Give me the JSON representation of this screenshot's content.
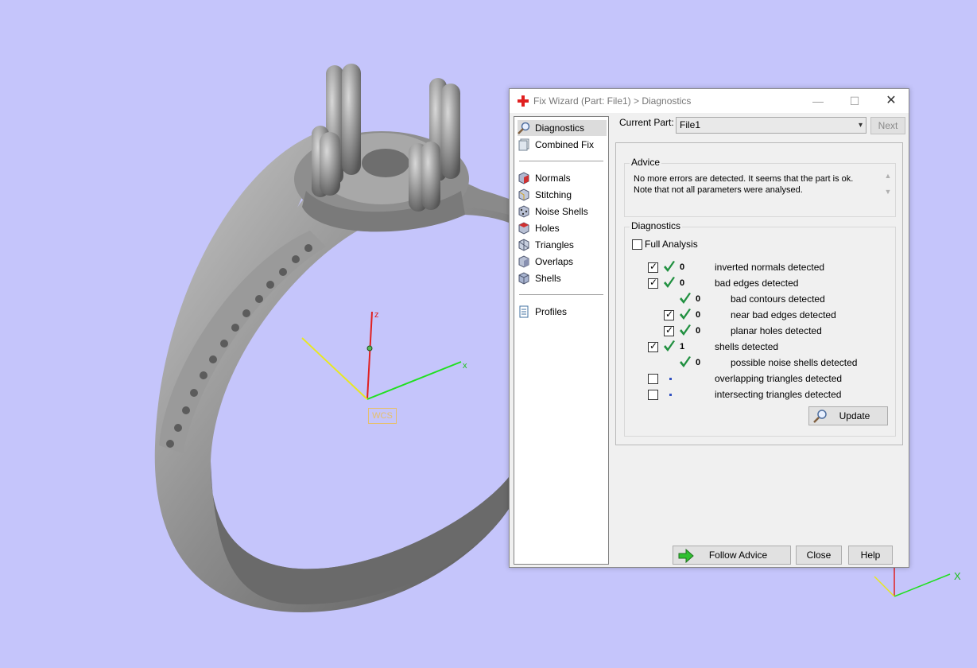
{
  "viewport": {
    "axes": {
      "z": "z",
      "x": "x",
      "small_x": "X"
    },
    "wcs_label": "WCS",
    "colors": {
      "background": "#c5c5fb",
      "z_axis": "#e02020",
      "x_axis": "#20e020",
      "y_axis": "#e8e820",
      "wcs": "#e6c06c"
    }
  },
  "window": {
    "title": "Fix Wizard (Part: File1) > Diagnostics",
    "controls": {
      "minimize": "—",
      "maximize": "☐",
      "close": "✕"
    }
  },
  "nav": {
    "top": [
      {
        "label": "Diagnostics",
        "icon": "magnifier-icon",
        "selected": true
      },
      {
        "label": "Combined Fix",
        "icon": "pages-icon"
      }
    ],
    "tools": [
      {
        "label": "Normals",
        "icon": "normals-cube-icon"
      },
      {
        "label": "Stitching",
        "icon": "stitching-cube-icon"
      },
      {
        "label": "Noise Shells",
        "icon": "noise-shells-cube-icon"
      },
      {
        "label": "Holes",
        "icon": "holes-cube-icon"
      },
      {
        "label": "Triangles",
        "icon": "triangles-cube-icon"
      },
      {
        "label": "Overlaps",
        "icon": "overlaps-cube-icon"
      },
      {
        "label": "Shells",
        "icon": "shells-cube-icon"
      }
    ],
    "bottom": [
      {
        "label": "Profiles",
        "icon": "document-icon"
      }
    ]
  },
  "current_part": {
    "label": "Current Part:",
    "value": "File1",
    "next": "Next"
  },
  "advice": {
    "title": "Advice",
    "line1": "No more errors are detected. It seems that the part is ok.",
    "line2": "Note that not all parameters were analysed."
  },
  "diagnostics": {
    "title": "Diagnostics",
    "full_analysis": {
      "label": "Full Analysis",
      "checked": false
    },
    "rows": [
      {
        "checkbox": true,
        "checked": true,
        "status": "ok",
        "count": "0",
        "label": "inverted normals detected",
        "indent": 0
      },
      {
        "checkbox": true,
        "checked": true,
        "status": "ok",
        "count": "0",
        "label": "bad edges detected",
        "indent": 0
      },
      {
        "checkbox": false,
        "status": "ok",
        "count": "0",
        "label": "bad contours detected",
        "indent": 1
      },
      {
        "checkbox": true,
        "checked": true,
        "status": "ok",
        "count": "0",
        "label": "near bad edges detected",
        "indent": 1
      },
      {
        "checkbox": true,
        "checked": true,
        "status": "ok",
        "count": "0",
        "label": "planar holes detected",
        "indent": 1
      },
      {
        "checkbox": true,
        "checked": true,
        "status": "ok",
        "count": "1",
        "label": "shells detected",
        "indent": 0
      },
      {
        "checkbox": false,
        "status": "ok",
        "count": "0",
        "label": "possible noise shells detected",
        "indent": 1
      },
      {
        "checkbox": true,
        "checked": false,
        "status": "unknown",
        "count": "",
        "label": "overlapping triangles detected",
        "indent": 0
      },
      {
        "checkbox": true,
        "checked": false,
        "status": "unknown",
        "count": "",
        "label": "intersecting triangles detected",
        "indent": 0
      }
    ],
    "update": "Update"
  },
  "footer": {
    "follow_advice": "Follow Advice",
    "close": "Close",
    "help": "Help"
  }
}
